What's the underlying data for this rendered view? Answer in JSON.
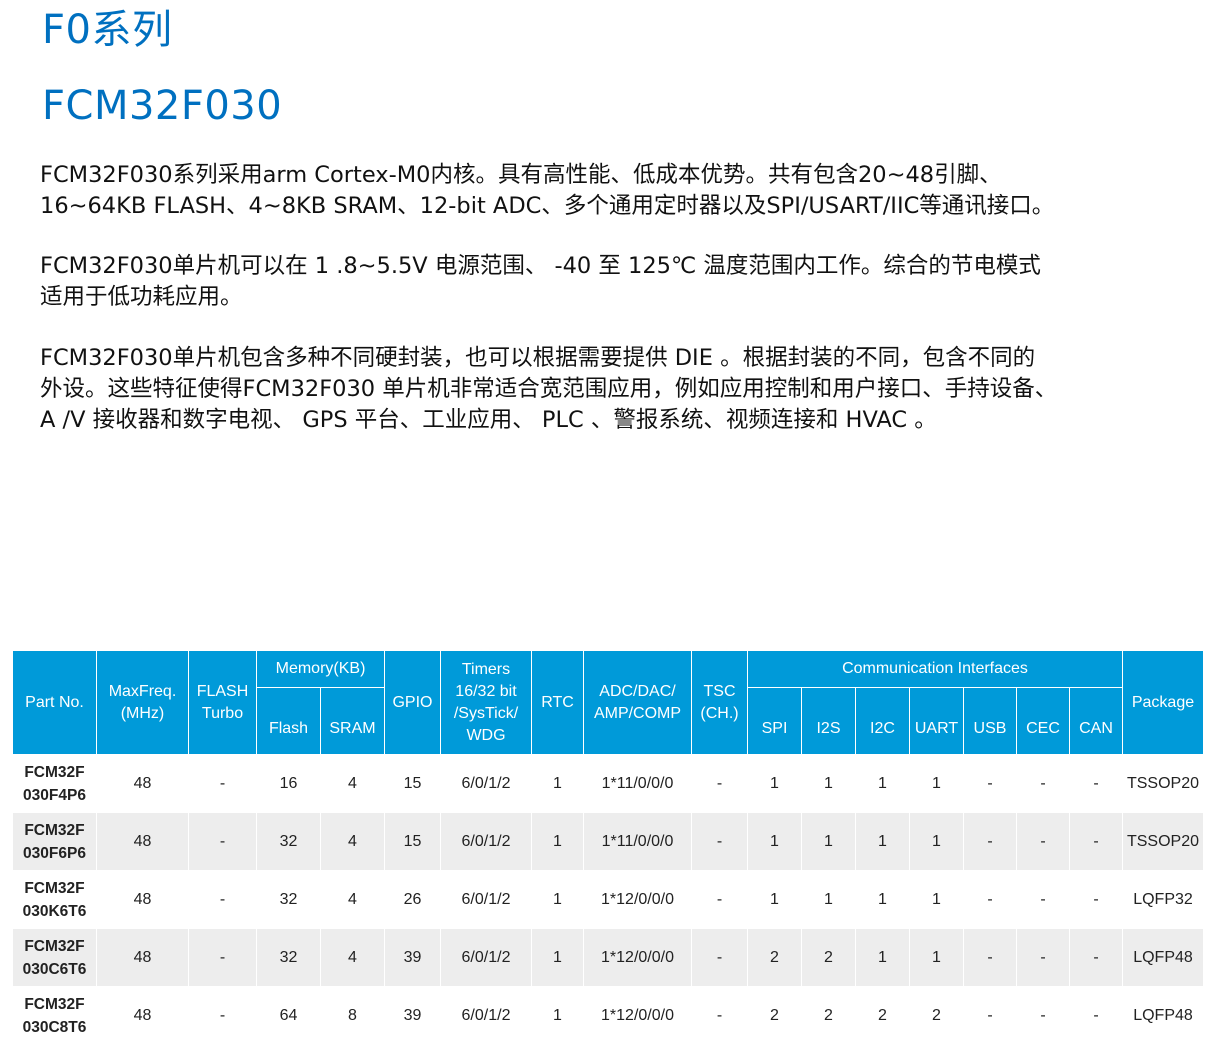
{
  "heading_series": "F0系列",
  "heading_model": "FCM32F030",
  "paragraphs": {
    "p1_line1": "FCM32F030系列采用arm Cortex-M0内核。具有高性能、低成本优势。共有包含20~48引脚、",
    "p1_line2": "16~64KB FLASH、4~8KB SRAM、12-bit ADC、多个通用定时器以及SPI/USART/IIC等通讯接口。",
    "p2_line1": "FCM32F030单片机可以在 1 .8~5.5V 电源范围、 -40 至 125℃ 温度范围内工作。综合的节电模式",
    "p2_line2": "适用于低功耗应用。",
    "p3_line1": "FCM32F030单片机包含多种不同硬封装，也可以根据需要提供 DIE 。根据封装的不同，包含不同的",
    "p3_line2": "外设。这些特征使得FCM32F030 单片机非常适合宽范围应用，例如应用控制和用户接口、手持设备、",
    "p3_line3": "A /V 接收器和数字电视、 GPS 平台、工业应用、 PLC 、警报系统、视频连接和 HVAC 。"
  },
  "table": {
    "headers": {
      "part_no": "Part No.",
      "maxfreq_l1": "MaxFreq.",
      "maxfreq_l2": "(MHz)",
      "flash_turbo_l1": "FLASH",
      "flash_turbo_l2": "Turbo",
      "memory": "Memory(KB)",
      "flash": "Flash",
      "sram": "SRAM",
      "gpio": "GPIO",
      "timers_l1": "Timers",
      "timers_l2": "16/32 bit",
      "timers_l3": "/SysTick/",
      "timers_l4": "WDG",
      "rtc": "RTC",
      "adc_l1": "ADC/DAC/",
      "adc_l2": "AMP/COMP",
      "tsc_l1": "TSC",
      "tsc_l2": "(CH.)",
      "comm": "Communication Interfaces",
      "spi": "SPI",
      "i2s": "I2S",
      "i2c": "I2C",
      "uart": "UART",
      "usb": "USB",
      "cec": "CEC",
      "can": "CAN",
      "package": "Package"
    },
    "rows": [
      {
        "part_l1": "FCM32F",
        "part_l2": "030F4P6",
        "maxfreq": "48",
        "turbo": "-",
        "flash": "16",
        "sram": "4",
        "gpio": "15",
        "timers": "6/0/1/2",
        "rtc": "1",
        "adc": "1*11/0/0/0",
        "tsc": "-",
        "spi": "1",
        "i2s": "1",
        "i2c": "1",
        "uart": "1",
        "usb": "-",
        "cec": "-",
        "can": "-",
        "package": "TSSOP20"
      },
      {
        "part_l1": "FCM32F",
        "part_l2": "030F6P6",
        "maxfreq": "48",
        "turbo": "-",
        "flash": "32",
        "sram": "4",
        "gpio": "15",
        "timers": "6/0/1/2",
        "rtc": "1",
        "adc": "1*11/0/0/0",
        "tsc": "-",
        "spi": "1",
        "i2s": "1",
        "i2c": "1",
        "uart": "1",
        "usb": "-",
        "cec": "-",
        "can": "-",
        "package": "TSSOP20"
      },
      {
        "part_l1": "FCM32F",
        "part_l2": "030K6T6",
        "maxfreq": "48",
        "turbo": "-",
        "flash": "32",
        "sram": "4",
        "gpio": "26",
        "timers": "6/0/1/2",
        "rtc": "1",
        "adc": "1*12/0/0/0",
        "tsc": "-",
        "spi": "1",
        "i2s": "1",
        "i2c": "1",
        "uart": "1",
        "usb": "-",
        "cec": "-",
        "can": "-",
        "package": "LQFP32"
      },
      {
        "part_l1": "FCM32F",
        "part_l2": "030C6T6",
        "maxfreq": "48",
        "turbo": "-",
        "flash": "32",
        "sram": "4",
        "gpio": "39",
        "timers": "6/0/1/2",
        "rtc": "1",
        "adc": "1*12/0/0/0",
        "tsc": "-",
        "spi": "2",
        "i2s": "2",
        "i2c": "1",
        "uart": "1",
        "usb": "-",
        "cec": "-",
        "can": "-",
        "package": "LQFP48"
      },
      {
        "part_l1": "FCM32F",
        "part_l2": "030C8T6",
        "maxfreq": "48",
        "turbo": "-",
        "flash": "64",
        "sram": "8",
        "gpio": "39",
        "timers": "6/0/1/2",
        "rtc": "1",
        "adc": "1*12/0/0/0",
        "tsc": "-",
        "spi": "2",
        "i2s": "2",
        "i2c": "2",
        "uart": "2",
        "usb": "-",
        "cec": "-",
        "can": "-",
        "package": "LQFP48"
      }
    ]
  },
  "colors": {
    "heading": "#0070c0",
    "table_header_bg": "#009ad9",
    "row_alt_bg": "#ededed"
  }
}
